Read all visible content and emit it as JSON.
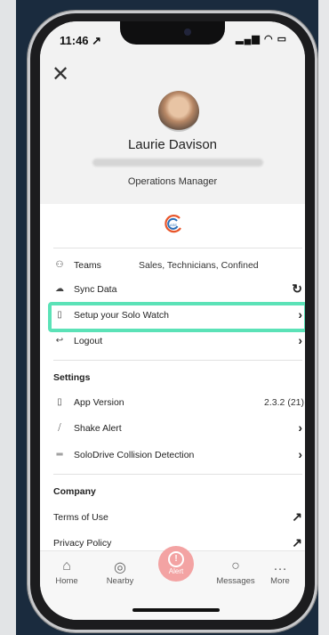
{
  "status": {
    "time": "11:46 ↗",
    "icons": "▂▄▆ ◠ ▭"
  },
  "header": {
    "close_icon": "✕",
    "name": "Laurie Davison",
    "role": "Operations Manager"
  },
  "menu": [
    {
      "icon": "⚇",
      "label": "Teams",
      "value": "Sales, Technicians, Confined",
      "chev": ""
    },
    {
      "icon": "☁",
      "label": "Sync Data",
      "value": "",
      "chev": "↻"
    },
    {
      "icon": "▯",
      "label": "Setup your Solo Watch",
      "value": "",
      "chev": "›"
    },
    {
      "icon": "↩",
      "label": "Logout",
      "value": "",
      "chev": "›"
    }
  ],
  "settings": {
    "title": "Settings",
    "items": [
      {
        "icon": "▯",
        "label": "App Version",
        "value": "2.3.2 (21)",
        "chev": ""
      },
      {
        "icon": "⧸",
        "label": "Shake Alert",
        "value": "",
        "chev": "›"
      },
      {
        "icon": "═",
        "label": "SoloDrive Collision Detection",
        "value": "",
        "chev": "›"
      }
    ]
  },
  "company": {
    "title": "Company",
    "items": [
      {
        "label": "Terms of Use",
        "chev": "↗"
      },
      {
        "label": "Privacy Policy",
        "chev": "↗"
      }
    ]
  },
  "tabs": {
    "home": {
      "icon": "⌂",
      "label": "Home"
    },
    "nearby": {
      "icon": "◎",
      "label": "Nearby"
    },
    "alert": {
      "icon": "!",
      "label": "Alert"
    },
    "messages": {
      "icon": "○",
      "label": "Messages"
    },
    "more": {
      "icon": "…",
      "label": "More"
    }
  },
  "colors": {
    "highlight": "#5be2b7",
    "alert": "#f3a3a3",
    "panel": "#1a2b3e"
  }
}
